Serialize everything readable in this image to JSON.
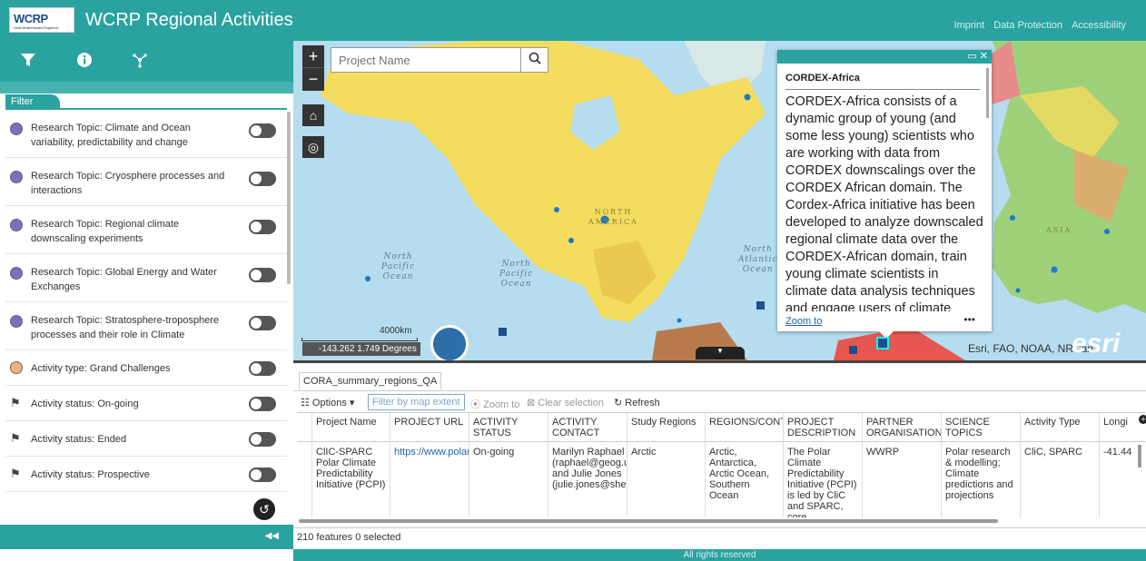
{
  "header": {
    "logo_text": "WCRP",
    "title": "WCRP Regional Activities",
    "links": [
      "Imprint",
      "Data Protection",
      "Accessibility"
    ]
  },
  "sidebar": {
    "tab_label": "Filter",
    "filters": [
      {
        "label": "Research Topic: Climate and Ocean variability, predictability and change",
        "symbol": "circle",
        "color": "#7b6fbf"
      },
      {
        "label": "Research Topic: Cryosphere processes and interactions",
        "symbol": "circle",
        "color": "#7b6fbf"
      },
      {
        "label": "Research Topic: Regional climate downscaling experiments",
        "symbol": "circle",
        "color": "#7b6fbf"
      },
      {
        "label": "Research Topic: Global Energy and Water Exchanges",
        "symbol": "circle",
        "color": "#7b6fbf"
      },
      {
        "label": "Research Topic: Stratosphere-troposphere processes and their role in Climate",
        "symbol": "circle",
        "color": "#7b6fbf"
      },
      {
        "label": "Activity type: Grand Challenges",
        "symbol": "circle",
        "color": "#f0b27a"
      },
      {
        "label": "Activity status: On-going",
        "symbol": "flag-icon"
      },
      {
        "label": "Activity status: Ended",
        "symbol": "flag-icon"
      },
      {
        "label": "Activity status: Prospective",
        "symbol": "flag-icon"
      }
    ]
  },
  "map": {
    "search_placeholder": "Project Name",
    "scale_label": "4000km",
    "coords": "-143.262 1.749 Degrees",
    "attribution": "Esri, FAO, NOAA, NRCan",
    "esri_logo": "esri",
    "labels": {
      "north_america": "NORTH\nAMERICA",
      "north_pacific": "North\nPacific\nOcean",
      "north_pacific_2": "North\nPacific\nOcean",
      "north_atlantic": "North\nAtlantic\nOcean",
      "asia": "ASIA"
    }
  },
  "popup": {
    "title": "CORDEX-Africa",
    "body": "CORDEX-Africa consists of a dynamic group of young (and some less young) scientists who are working with data from CORDEX downscalings over the CORDEX African domain. The Cordex-Africa initiative has been developed to analyze downscaled regional climate data over the CORDEX-African domain, train young climate scientists in climate data analysis techniques and engage users of climate information in both",
    "zoom_to": "Zoom to",
    "more": "•••"
  },
  "table": {
    "tab_label": "CORA_summary_regions_QA",
    "toolbar": {
      "options": "Options",
      "filter_extent": "Filter by map extent",
      "zoom_to": "Zoom to",
      "clear_selection": "Clear selection",
      "refresh": "Refresh"
    },
    "columns": [
      "Project Name",
      "PROJECT URL",
      "ACTIVITY STATUS",
      "ACTIVITY CONTACT",
      "Study Regions",
      "REGIONS/CONTI",
      "PROJECT DESCRIPTION",
      "PARTNER ORGANISATION",
      "SCIENCE TOPICS",
      "Activity Type",
      "Longi"
    ],
    "row": {
      "project_name": "ClIC-SPARC Polar Climate Predictability Initiative (PCPI)",
      "project_url": "https://www.polar",
      "status": "On-going",
      "contact_1": "Marilyn Raphael",
      "contact_2": "(raphael@geog.u",
      "contact_3": "and Julie Jones",
      "contact_4": "(julie.jones@sheff",
      "study_regions": "Arctic",
      "regions": "Arctic, Antarctica, Arctic Ocean, Southern Ocean",
      "description": "The Polar Climate Predictability Initiative (PCPI) is led by CliC and SPARC, core",
      "partner": "WWRP",
      "science": "Polar research & modelling; Climate predictions and projections",
      "type": "CliC, SPARC",
      "longitude": "-41.44"
    },
    "status": "210 features 0 selected"
  },
  "footer": {
    "text": "All rights reserved"
  },
  "colors": {
    "brand": "#2aa3a0",
    "ocean": "#b6dcef",
    "land_north_america": "#f3dc5e",
    "land_asia": "#9fd07a",
    "land_africa": "#e8574f",
    "marker": "#1e78c8"
  }
}
